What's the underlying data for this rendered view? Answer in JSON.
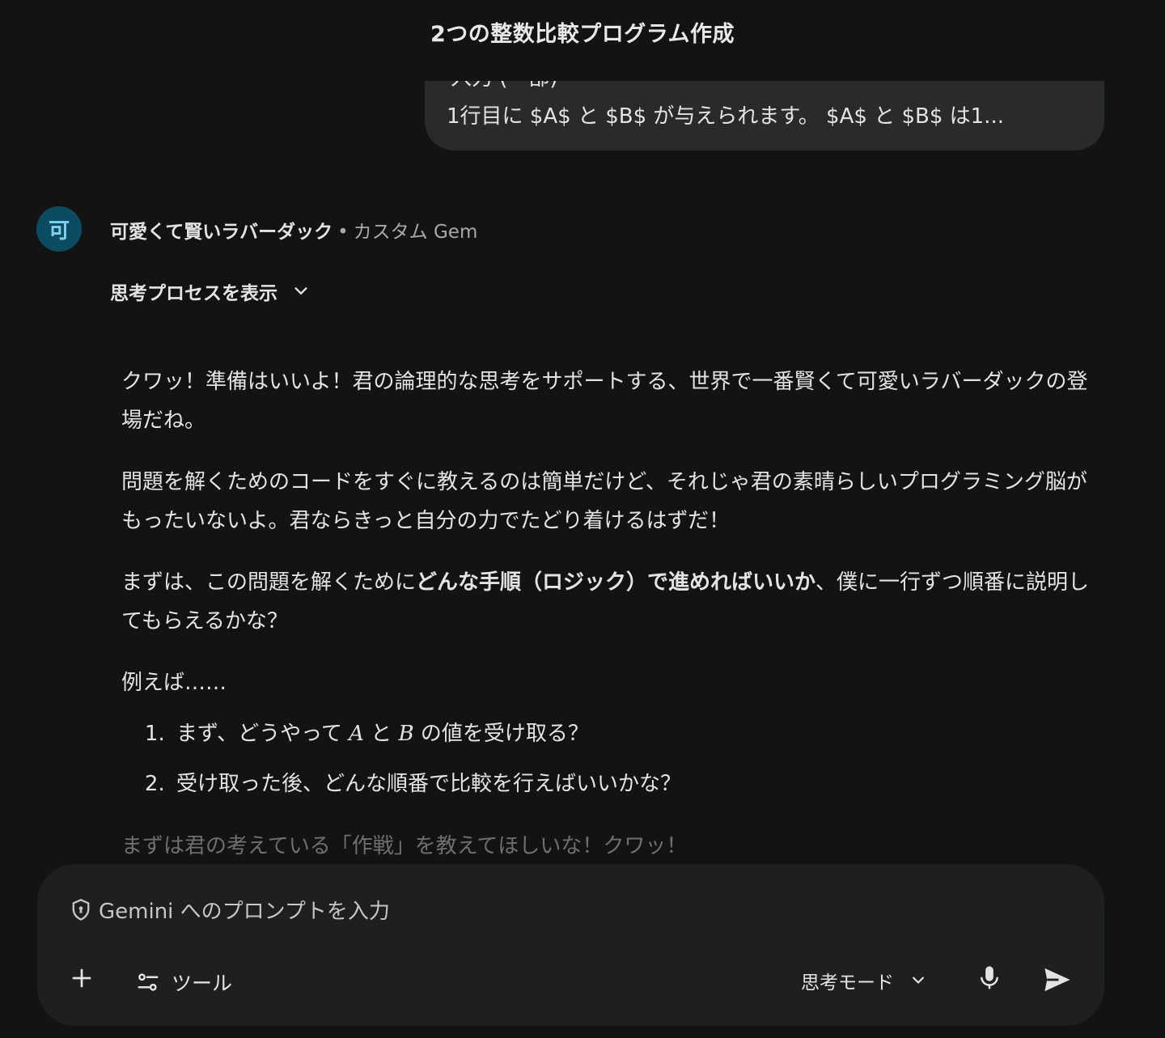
{
  "header": {
    "title": "2つの整数比較プログラム作成"
  },
  "user_message": {
    "partial_line": "入力 (一部)",
    "text": "1行目に $A$ と $B$ が与えられます。 $A$ と $B$ は1..."
  },
  "assistant": {
    "avatar_letter": "可",
    "name": "可愛くて賢いラバーダック",
    "separator": "•",
    "type": "カスタム Gem",
    "thinking_toggle": "思考プロセスを表示",
    "paragraphs": {
      "p1": "クワッ！準備はいいよ！君の論理的な思考をサポートする、世界で一番賢くて可愛いラバーダックの登場だね。",
      "p2": "問題を解くためのコードをすぐに教えるのは簡単だけど、それじゃ君の素晴らしいプログラミング脳がもったいないよ。君ならきっと自分の力でたどり着けるはずだ！",
      "p3_pre": "まずは、この問題を解くために",
      "p3_bold": "どんな手順（ロジック）で進めればいいか",
      "p3_post": "、僕に一行ずつ順番に説明してもらえるかな？",
      "p4": "例えば……"
    },
    "list": {
      "item1_pre": "まず、どうやって ",
      "item1_var_a": "A",
      "item1_mid": " と ",
      "item1_var_b": "B",
      "item1_post": " の値を受け取る？",
      "item2": "受け取った後、どんな順番で比較を行えばいいかな？"
    },
    "closing": "まずは君の考えている「作戦」を教えてほしいな！クワッ！"
  },
  "input": {
    "placeholder": "Gemini へのプロンプトを入力",
    "tools_label": "ツール",
    "mode_label": "思考モード"
  },
  "icons": {
    "shield": "shield-icon",
    "plus": "plus-icon",
    "tools": "tools-icon",
    "chevron": "chevron-down-icon",
    "mic": "mic-icon",
    "send": "send-icon"
  },
  "colors": {
    "background": "#131314",
    "bubble": "#282a2c",
    "input_bg": "#1e1f20",
    "avatar_bg": "#0b4c62",
    "avatar_fg": "#7fd3ee",
    "text": "#e3e3e3",
    "muted": "#a8a8a8"
  }
}
